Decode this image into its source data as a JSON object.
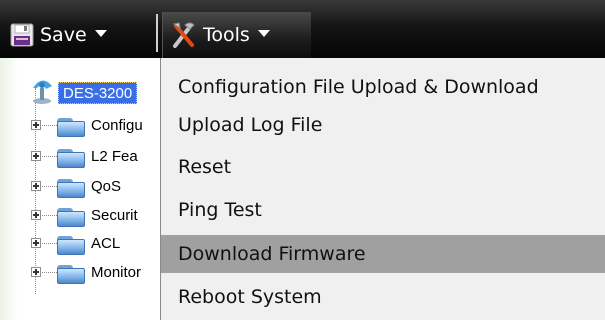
{
  "toolbar": {
    "save": {
      "label": "Save",
      "icon": "floppy-disk-icon"
    },
    "tools": {
      "label": "Tools",
      "icon": "tools-icon"
    }
  },
  "tree": {
    "root": {
      "label": "DES-3200",
      "icon": "switch-device-icon",
      "selected": true
    },
    "items": [
      {
        "label": "Configu",
        "icon": "folder-icon"
      },
      {
        "label": "L2 Fea",
        "icon": "folder-icon"
      },
      {
        "label": "QoS",
        "icon": "folder-icon"
      },
      {
        "label": "Securit",
        "icon": "folder-icon"
      },
      {
        "label": "ACL",
        "icon": "folder-icon"
      },
      {
        "label": "Monitor",
        "icon": "folder-icon"
      }
    ]
  },
  "menu": {
    "items": [
      {
        "label": "Configuration File Upload & Download"
      },
      {
        "label": "Upload Log File"
      },
      {
        "label": "Reset"
      },
      {
        "label": "Ping Test"
      },
      {
        "label": "Download Firmware",
        "highlighted": true
      },
      {
        "label": "Reboot System"
      }
    ]
  },
  "colors": {
    "toolbar_bg": "#0d0d0d",
    "menu_bg": "#f0f0f0",
    "menu_highlight": "#a0a0a0",
    "selection": "#3a6ee8"
  }
}
